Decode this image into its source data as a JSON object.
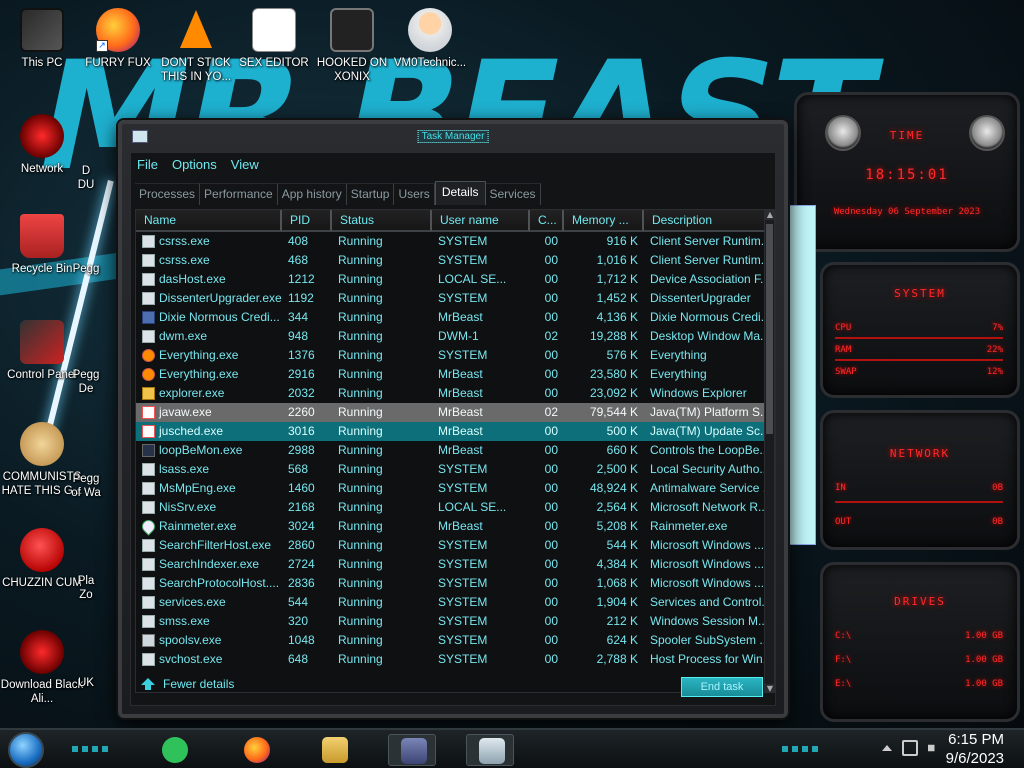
{
  "desktop": {
    "icons": [
      {
        "label": "This PC",
        "icon": "pc-icon"
      },
      {
        "label": "FURRY FUX",
        "icon": "firefox-icon"
      },
      {
        "label": "DONT STICK THIS IN YO...",
        "icon": "vlc-icon"
      },
      {
        "label": "SEX EDITOR",
        "icon": "hex-editor-icon"
      },
      {
        "label": "HOOKED ON XONIX",
        "icon": "xonix-icon"
      },
      {
        "label": "VM0Technic...",
        "icon": "doctor-icon"
      },
      {
        "label": "Network",
        "icon": "network-icon"
      },
      {
        "label": "Recycle Bin",
        "icon": "recycle-bin-icon"
      },
      {
        "label": "Control Panel",
        "icon": "control-panel-icon"
      },
      {
        "label": "COMMUNISTS HATE THIS G...",
        "icon": "money-bag-icon"
      },
      {
        "label": "CHUZZIN CUM",
        "icon": "chuzzle-icon"
      },
      {
        "label": "Download Black Ali...",
        "icon": "alien-icon"
      }
    ],
    "partial_labels": [
      "D",
      "DU",
      "Pegg",
      "Pegg",
      "De",
      "Pegg",
      "of Wa",
      "Pla",
      "Zo",
      "UK"
    ]
  },
  "widgets": {
    "time": {
      "title": "TIME",
      "clock": "18:15:01",
      "date": "Wednesday 06 September 2023"
    },
    "system": {
      "title": "SYSTEM",
      "rows": [
        {
          "label": "CPU",
          "value": "7%"
        },
        {
          "label": "RAM",
          "value": "22%"
        },
        {
          "label": "SWAP",
          "value": "12%"
        }
      ]
    },
    "network": {
      "title": "NETWORK",
      "rows": [
        {
          "label": "IN",
          "value": "0B"
        },
        {
          "label": "OUT",
          "value": "0B"
        }
      ]
    },
    "drives": {
      "title": "DRIVES",
      "rows": [
        {
          "label": "C:\\",
          "value": "1.00 GB"
        },
        {
          "label": "F:\\",
          "value": "1.00 GB"
        },
        {
          "label": "E:\\",
          "value": "1.00 GB"
        }
      ]
    }
  },
  "window": {
    "title": "Task Manager",
    "menu": [
      "File",
      "Options",
      "View"
    ],
    "tabs": [
      "Processes",
      "Performance",
      "App history",
      "Startup",
      "Users",
      "Details",
      "Services"
    ],
    "active_tab": "Details",
    "columns": [
      "Name",
      "PID",
      "Status",
      "User name",
      "C...",
      "Memory ...",
      "Description"
    ],
    "rows": [
      {
        "name": "csrss.exe",
        "pid": "408",
        "status": "Running",
        "user": "SYSTEM",
        "cpu": "00",
        "memory": "916 K",
        "desc": "Client Server Runtim...",
        "icon": "cmd"
      },
      {
        "name": "csrss.exe",
        "pid": "468",
        "status": "Running",
        "user": "SYSTEM",
        "cpu": "00",
        "memory": "1,016 K",
        "desc": "Client Server Runtim...",
        "icon": "cmd"
      },
      {
        "name": "dasHost.exe",
        "pid": "1212",
        "status": "Running",
        "user": "LOCAL SE...",
        "cpu": "00",
        "memory": "1,712 K",
        "desc": "Device Association F...",
        "icon": "cmd"
      },
      {
        "name": "DissenterUpgrader.exe",
        "pid": "1192",
        "status": "Running",
        "user": "SYSTEM",
        "cpu": "00",
        "memory": "1,452 K",
        "desc": "DissenterUpgrader",
        "icon": "cmd"
      },
      {
        "name": "Dixie Normous Credi...",
        "pid": "344",
        "status": "Running",
        "user": "MrBeast",
        "cpu": "00",
        "memory": "4,136 K",
        "desc": "Dixie Normous Credi...",
        "icon": "blue"
      },
      {
        "name": "dwm.exe",
        "pid": "948",
        "status": "Running",
        "user": "DWM-1",
        "cpu": "02",
        "memory": "19,288 K",
        "desc": "Desktop Window Ma...",
        "icon": "cmd"
      },
      {
        "name": "Everything.exe",
        "pid": "1376",
        "status": "Running",
        "user": "SYSTEM",
        "cpu": "00",
        "memory": "576 K",
        "desc": "Everything",
        "icon": "orange"
      },
      {
        "name": "Everything.exe",
        "pid": "2916",
        "status": "Running",
        "user": "MrBeast",
        "cpu": "00",
        "memory": "23,580 K",
        "desc": "Everything",
        "icon": "orange"
      },
      {
        "name": "explorer.exe",
        "pid": "2032",
        "status": "Running",
        "user": "MrBeast",
        "cpu": "00",
        "memory": "23,092 K",
        "desc": "Windows Explorer",
        "icon": "folder"
      },
      {
        "name": "javaw.exe",
        "pid": "2260",
        "status": "Running",
        "user": "MrBeast",
        "cpu": "02",
        "memory": "79,544 K",
        "desc": "Java(TM) Platform S...",
        "icon": "java",
        "state": "hover"
      },
      {
        "name": "jusched.exe",
        "pid": "3016",
        "status": "Running",
        "user": "MrBeast",
        "cpu": "00",
        "memory": "500 K",
        "desc": "Java(TM) Update Sc...",
        "icon": "java",
        "state": "selected"
      },
      {
        "name": "loopBeMon.exe",
        "pid": "2988",
        "status": "Running",
        "user": "MrBeast",
        "cpu": "00",
        "memory": "660 K",
        "desc": "Controls the LoopBe...",
        "icon": "dark"
      },
      {
        "name": "lsass.exe",
        "pid": "568",
        "status": "Running",
        "user": "SYSTEM",
        "cpu": "00",
        "memory": "2,500 K",
        "desc": "Local Security Autho...",
        "icon": "cmd"
      },
      {
        "name": "MsMpEng.exe",
        "pid": "1460",
        "status": "Running",
        "user": "SYSTEM",
        "cpu": "00",
        "memory": "48,924 K",
        "desc": "Antimalware Service ...",
        "icon": "cmd"
      },
      {
        "name": "NisSrv.exe",
        "pid": "2168",
        "status": "Running",
        "user": "LOCAL SE...",
        "cpu": "00",
        "memory": "2,564 K",
        "desc": "Microsoft Network R...",
        "icon": "cmd"
      },
      {
        "name": "Rainmeter.exe",
        "pid": "3024",
        "status": "Running",
        "user": "MrBeast",
        "cpu": "00",
        "memory": "5,208 K",
        "desc": "Rainmeter.exe",
        "icon": "drop"
      },
      {
        "name": "SearchFilterHost.exe",
        "pid": "2860",
        "status": "Running",
        "user": "SYSTEM",
        "cpu": "00",
        "memory": "544 K",
        "desc": "Microsoft Windows ...",
        "icon": "cmd"
      },
      {
        "name": "SearchIndexer.exe",
        "pid": "2724",
        "status": "Running",
        "user": "SYSTEM",
        "cpu": "00",
        "memory": "4,384 K",
        "desc": "Microsoft Windows ...",
        "icon": "cmd"
      },
      {
        "name": "SearchProtocolHost....",
        "pid": "2836",
        "status": "Running",
        "user": "SYSTEM",
        "cpu": "00",
        "memory": "1,068 K",
        "desc": "Microsoft Windows ...",
        "icon": "cmd"
      },
      {
        "name": "services.exe",
        "pid": "544",
        "status": "Running",
        "user": "SYSTEM",
        "cpu": "00",
        "memory": "1,904 K",
        "desc": "Services and Control...",
        "icon": "cmd"
      },
      {
        "name": "smss.exe",
        "pid": "320",
        "status": "Running",
        "user": "SYSTEM",
        "cpu": "00",
        "memory": "212 K",
        "desc": "Windows Session M...",
        "icon": "cmd"
      },
      {
        "name": "spoolsv.exe",
        "pid": "1048",
        "status": "Running",
        "user": "SYSTEM",
        "cpu": "00",
        "memory": "624 K",
        "desc": "Spooler SubSystem ...",
        "icon": "printer"
      },
      {
        "name": "svchost.exe",
        "pid": "648",
        "status": "Running",
        "user": "SYSTEM",
        "cpu": "00",
        "memory": "2,788 K",
        "desc": "Host Process for Win...",
        "icon": "cmd"
      }
    ],
    "footer": {
      "fewer_details": "Fewer details",
      "end_task": "End task"
    }
  },
  "taskbar": {
    "apps": [
      "notes-icon",
      "firefox-icon",
      "file-explorer-icon",
      "control-panel-icon",
      "task-manager-icon"
    ],
    "clock_time": "6:15 PM",
    "clock_date": "9/6/2023"
  }
}
